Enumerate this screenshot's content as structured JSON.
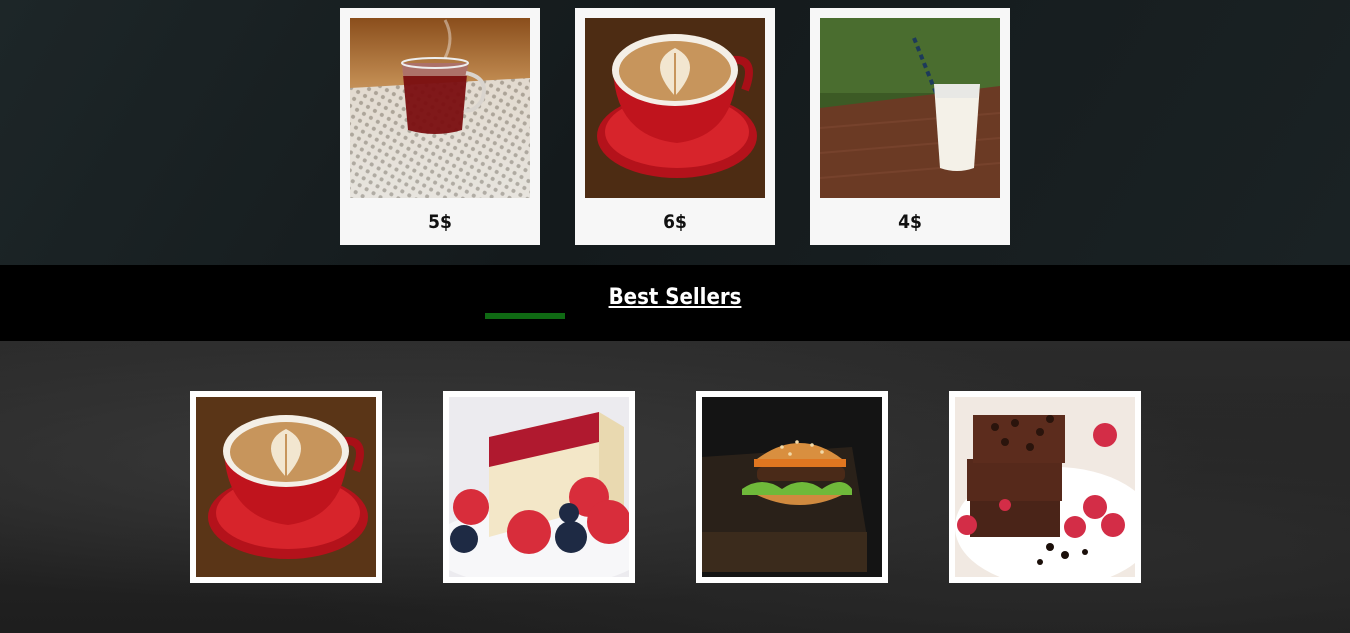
{
  "drinks": [
    {
      "name": "tea",
      "price": "5$"
    },
    {
      "name": "latte",
      "price": "6$"
    },
    {
      "name": "milk",
      "price": "4$"
    }
  ],
  "best_sellers": {
    "title": "Best Sellers",
    "accent_color": "#0f6a13",
    "items": [
      "latte",
      "cheesecake",
      "burger",
      "brownie"
    ]
  }
}
